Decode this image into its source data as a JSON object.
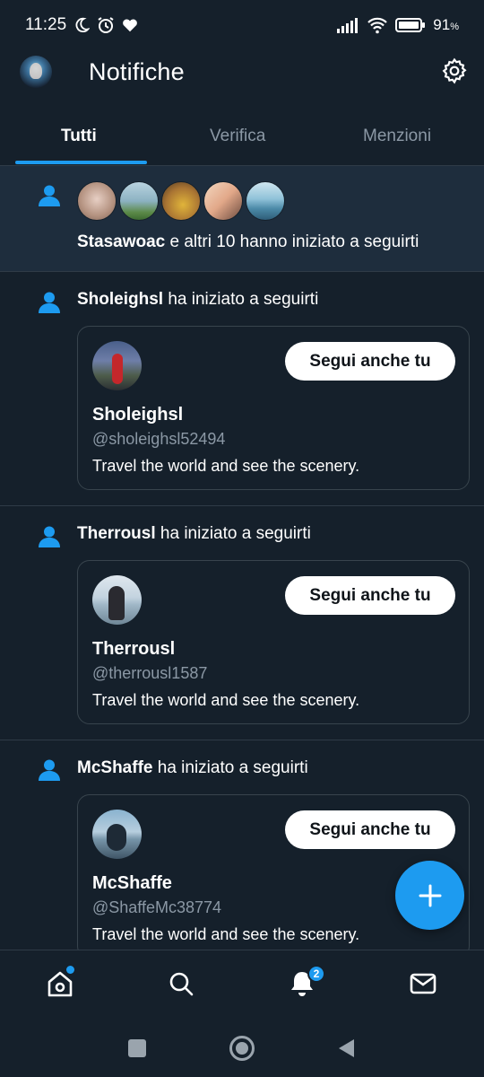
{
  "status_bar": {
    "time": "11:25",
    "battery": "91",
    "battery_unit": "%"
  },
  "header": {
    "title": "Notifiche"
  },
  "tabs": [
    {
      "label": "Tutti",
      "active": true
    },
    {
      "label": "Verifica",
      "active": false
    },
    {
      "label": "Menzioni",
      "active": false
    }
  ],
  "group_notification": {
    "name": "Stasawoac",
    "text": " e altri 10 hanno iniziato a seguirti",
    "avatar_colors": [
      "#c9a89a",
      "#7fa6b3",
      "#b88a4a",
      "#e6b89a",
      "#6fa8c2"
    ]
  },
  "notifications": [
    {
      "name": "Sholeighsl",
      "action": " ha iniziato a seguirti",
      "follow_label": "Segui anche tu",
      "display_name": "Sholeighsl",
      "handle": "@sholeighsl52494",
      "bio": "Travel the world and see the scenery."
    },
    {
      "name": "Therrousl",
      "action": " ha iniziato a seguirti",
      "follow_label": "Segui anche tu",
      "display_name": "Therrousl",
      "handle": "@therrousl1587",
      "bio": "Travel the world and see the scenery."
    },
    {
      "name": "McShaffe",
      "action": " ha iniziato a seguirti",
      "follow_label": "Segui anche tu",
      "display_name": "McShaffe",
      "handle": "@ShaffeMc38774",
      "bio": "Travel the world and see the scenery."
    }
  ],
  "bottom_nav": {
    "items": [
      "home-icon",
      "search-icon",
      "bell-icon",
      "mail-icon"
    ],
    "notification_badge": "2"
  },
  "colors": {
    "background": "#15202b",
    "accent": "#1d9bf0",
    "highlight_row": "#1e2d3d"
  }
}
